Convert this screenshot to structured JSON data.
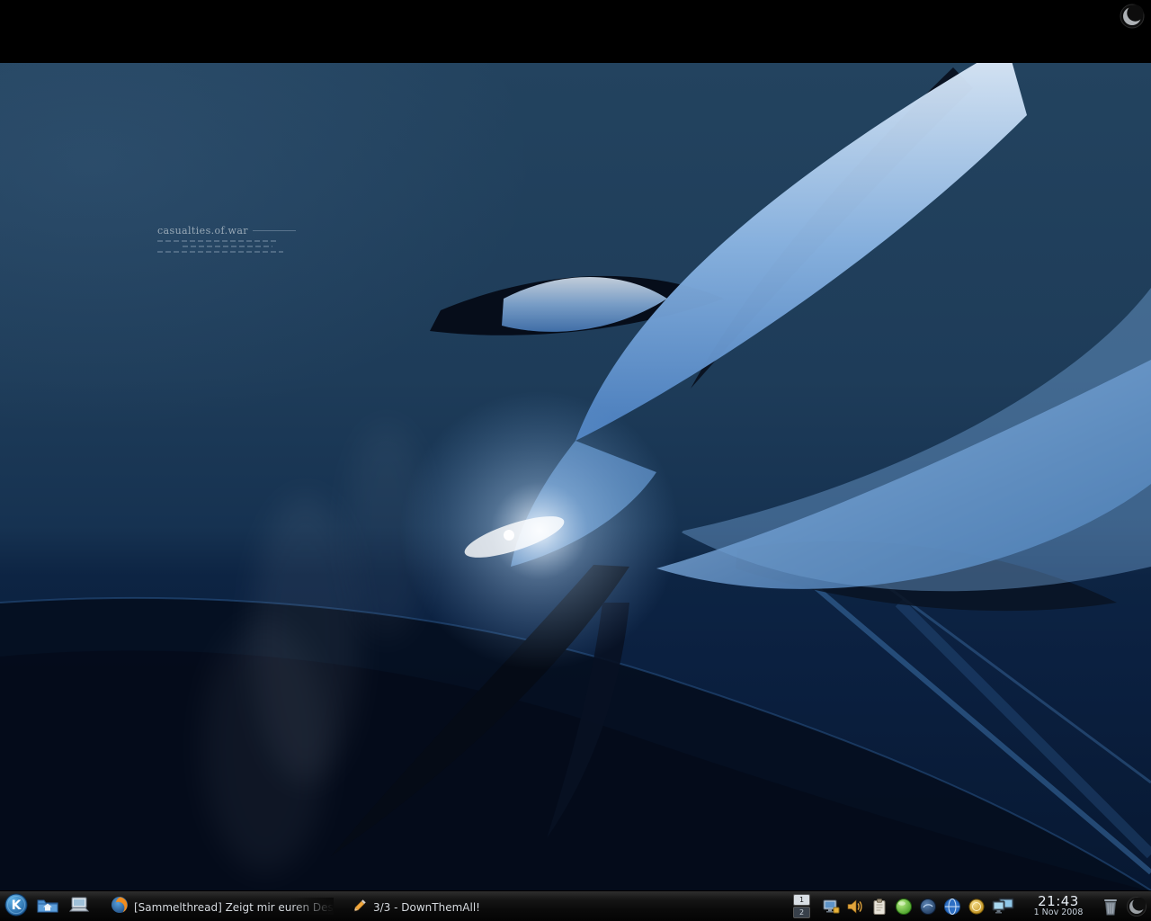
{
  "desktop": {
    "caption_title": "casualties.of.war"
  },
  "panel": {
    "launcher_icons": [
      "kde-kickoff-menu-icon",
      "home-folder-icon",
      "laptop-icon"
    ],
    "tasks": [
      {
        "icon": "firefox-icon",
        "label": "[Sammelthread] Zeigt mir euren Desk"
      },
      {
        "icon": "pencil-icon",
        "label": "3/3 - DownThemAll!"
      }
    ],
    "pager": {
      "desktop1": "1",
      "desktop2": "2"
    },
    "tray_icons": [
      "network-monitor-icon",
      "volume-icon",
      "clipboard-icon",
      "green-orb-icon",
      "swirl-orb-icon",
      "blue-globe-icon",
      "gold-orb-icon",
      "dual-display-icon"
    ],
    "clock": {
      "time": "21:43",
      "date": "1 Nov 2008"
    }
  },
  "colors": {
    "panel_bg": "#0b0b0b",
    "wallpaper_base": "#1e3c59",
    "wallpaper_deep": "#071832",
    "accent_blue": "#7fb0e0"
  }
}
